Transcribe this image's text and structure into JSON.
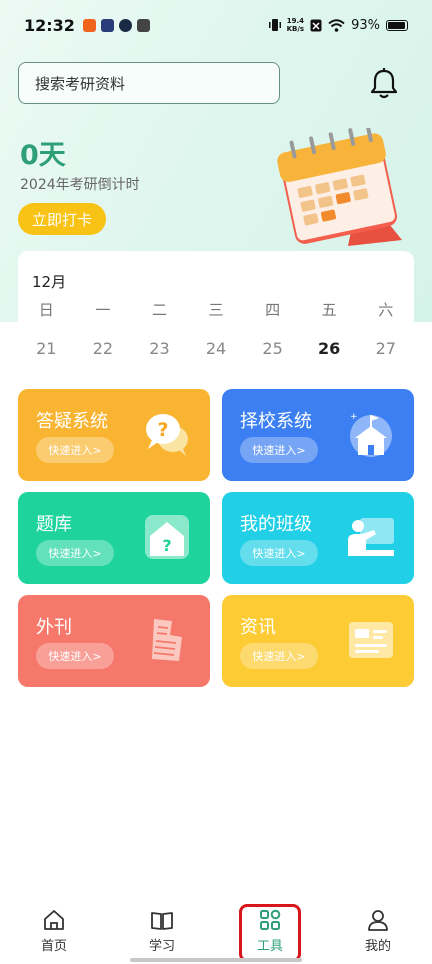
{
  "status_bar": {
    "time": "12:32",
    "net_speed_value": "19.4",
    "net_speed_unit": "KB/s",
    "battery": "93%"
  },
  "search": {
    "placeholder": "搜索考研资料"
  },
  "countdown": {
    "days": "0天",
    "label": "2024年考研倒计时",
    "checkin_label": "立即打卡"
  },
  "calendar": {
    "month": "12月",
    "weekdays": [
      "日",
      "一",
      "二",
      "三",
      "四",
      "五",
      "六"
    ],
    "dates": [
      "21",
      "22",
      "23",
      "24",
      "25",
      "26",
      "27"
    ],
    "today": "26"
  },
  "tools": [
    {
      "title": "答疑系统",
      "button": "快速进入>",
      "color": "#f9b531",
      "icon": "question-bubble-icon"
    },
    {
      "title": "择校系统",
      "button": "快速进入>",
      "color": "#3b7ff2",
      "icon": "school-icon"
    },
    {
      "title": "题库",
      "button": "快速进入>",
      "color": "#1fd49c",
      "icon": "question-house-icon"
    },
    {
      "title": "我的班级",
      "button": "快速进入>",
      "color": "#21d0e6",
      "icon": "classroom-teacher-icon"
    },
    {
      "title": "外刊",
      "button": "快速进入>",
      "color": "#f5786a",
      "icon": "newspaper-icon"
    },
    {
      "title": "资讯",
      "button": "快速进入>",
      "color": "#fdcb33",
      "icon": "news-card-icon"
    }
  ],
  "tabbar": {
    "items": [
      {
        "label": "首页",
        "icon": "home-icon"
      },
      {
        "label": "学习",
        "icon": "book-icon"
      },
      {
        "label": "工具",
        "icon": "tools-grid-icon",
        "active": true
      },
      {
        "label": "我的",
        "icon": "user-icon"
      }
    ],
    "active_color": "#2e9f76",
    "highlight_color": "#d8161b"
  }
}
